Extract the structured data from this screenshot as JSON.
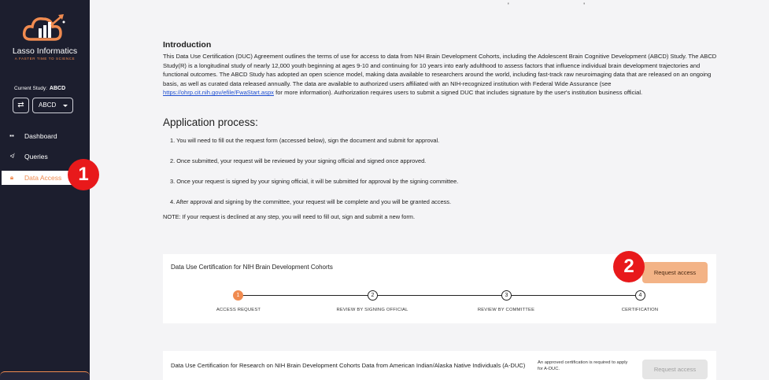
{
  "sidebar": {
    "logo_name": "Lasso Informatics",
    "logo_tagline": "A FASTER TIME TO SCIENCE",
    "current_study_label": "Current Study:",
    "current_study_value": "ABCD",
    "swap_icon": "swap-arrows-icon",
    "study_select_value": "ABCD",
    "nav": [
      {
        "label": "Dashboard",
        "icon": "grid-icon"
      },
      {
        "label": "Queries",
        "icon": "query-icon"
      },
      {
        "label": "Data Access",
        "icon": "lock-icon",
        "active": true
      }
    ]
  },
  "annotations": {
    "badge1": "1",
    "badge2": "2"
  },
  "intro": {
    "title": "Introduction",
    "text_before_link": "This Data Use Certification (DUC) Agreement outlines the terms of use for access to data from NIH Brain Development Cohorts, including the Adolescent Brain Cognitive Development (ABCD) Study. The ABCD Study(R) is a longitudinal study of nearly 12,000 youth beginning at ages 9-10 and continuing for 10 years into early adulthood to assess factors that influence individual brain development trajectories and functional outcomes. The ABCD Study has adopted an open science model, making data available to researchers around the world, including fast-track raw neuroimaging data that are released on an ongoing basis, as well as curated data released annually. The data are available to authorized users affiliated with an NIH-recognized institution with Federal Wide Assurance (see ",
    "link": "https://ohrp.cit.nih.gov/efile/FwaStart.aspx",
    "text_after_link": " for more information). Authorization requires users to submit a signed DUC that includes signature by the user's institution business official."
  },
  "application": {
    "title": "Application process:",
    "steps": [
      "1. You will need to fill out the request form (accessed below), sign the document and submit for approval.",
      "2. Once submitted, your request will be reviewed by your signing official and signed once approved.",
      "3. Once your request is signed by your signing official, it will be submitted for approval by the signing committee.",
      "4. After approval and signing by the committee, your request will be complete and you will be granted access."
    ],
    "note": "NOTE: If your request is declined at any step, you will need to fill out, sign and submit a new form."
  },
  "card1": {
    "title": "Data Use Certification for NIH Brain Development Cohorts",
    "button": "Request access",
    "steps": [
      {
        "num": "1",
        "label": "ACCESS REQUEST",
        "active": true
      },
      {
        "num": "2",
        "label": "REVIEW BY SIGNING OFFICIAL"
      },
      {
        "num": "3",
        "label": "REVIEW BY COMMITTEE"
      },
      {
        "num": "4",
        "label": "CERTIFICATION"
      }
    ]
  },
  "card2": {
    "title": "Data Use Certification for Research on NIH Brain Development Cohorts Data from American Indian/Alaska Native Individuals (A-DUC)",
    "note": "An approved certification is required to apply for A-DUC.",
    "button": "Request access"
  },
  "colors": {
    "accent": "#f08b50",
    "sidebar": "#1c1e2e",
    "badge": "#e8191b",
    "button": "#f3b386"
  }
}
